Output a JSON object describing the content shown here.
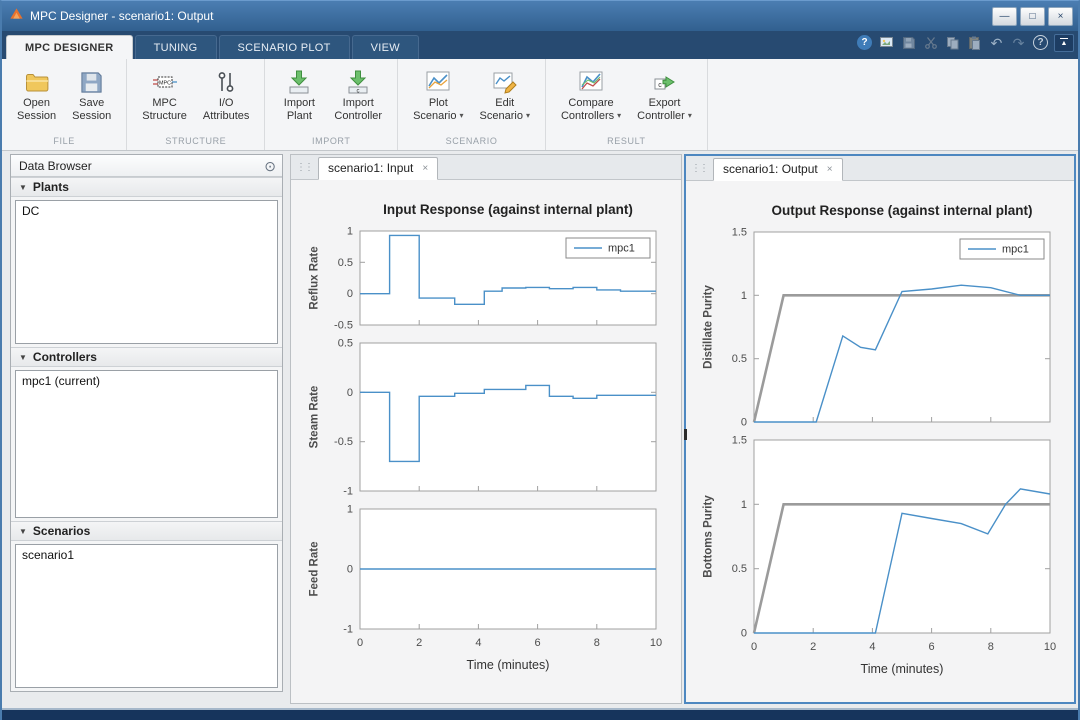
{
  "window": {
    "title": "MPC Designer - scenario1: Output",
    "controls": {
      "minimize": "—",
      "maximize": "□",
      "close": "×"
    }
  },
  "icons": {
    "dropdown_arrow": "▾",
    "section_collapse": "▼",
    "close_tab": "×",
    "help_glyph": "?",
    "undo_glyph": "↶",
    "redo_glyph": "↷",
    "panel_menu_glyph": "⊙",
    "handle_glyph": "⋮⋮",
    "collapse_ribbon_glyph": "▲",
    "mpc_badge": "MPC",
    "controller_badge": "c"
  },
  "ribbon": {
    "tabs": [
      {
        "label": "MPC DESIGNER",
        "active": true
      },
      {
        "label": "TUNING",
        "active": false
      },
      {
        "label": "SCENARIO PLOT",
        "active": false
      },
      {
        "label": "VIEW",
        "active": false
      }
    ],
    "quick_access": [
      "help",
      "screenshot",
      "save",
      "cut",
      "copy",
      "paste",
      "undo",
      "redo",
      "help-circle",
      "minimize-ribbon"
    ],
    "groups": [
      {
        "label": "FILE",
        "buttons": [
          {
            "line1": "Open",
            "line2": "Session",
            "menu": false
          },
          {
            "line1": "Save",
            "line2": "Session",
            "menu": false
          }
        ]
      },
      {
        "label": "STRUCTURE",
        "buttons": [
          {
            "line1": "MPC",
            "line2": "Structure",
            "menu": false
          },
          {
            "line1": "I/O",
            "line2": "Attributes",
            "menu": false
          }
        ]
      },
      {
        "label": "IMPORT",
        "buttons": [
          {
            "line1": "Import",
            "line2": "Plant",
            "menu": false
          },
          {
            "line1": "Import",
            "line2": "Controller",
            "menu": false
          }
        ]
      },
      {
        "label": "SCENARIO",
        "buttons": [
          {
            "line1": "Plot",
            "line2": "Scenario",
            "menu": true
          },
          {
            "line1": "Edit",
            "line2": "Scenario",
            "menu": true
          }
        ]
      },
      {
        "label": "RESULT",
        "buttons": [
          {
            "line1": "Compare",
            "line2": "Controllers",
            "menu": true
          },
          {
            "line1": "Export",
            "line2": "Controller",
            "menu": true
          }
        ]
      }
    ]
  },
  "data_browser": {
    "title": "Data Browser",
    "sections": [
      {
        "label": "Plants",
        "items": [
          "DC"
        ]
      },
      {
        "label": "Controllers",
        "items": [
          "mpc1 (current)"
        ]
      },
      {
        "label": "Scenarios",
        "items": [
          "scenario1"
        ]
      }
    ]
  },
  "documents": [
    {
      "tab": "scenario1: Input"
    },
    {
      "tab": "scenario1: Output",
      "focused": true
    }
  ],
  "colors": {
    "mpc_line": "#4a90c8",
    "reference_line": "#9b9b9b",
    "focus_border": "#4d87c0",
    "titlebar": "#31608f"
  },
  "chart_data": [
    {
      "type": "line",
      "title": "Input Response (against internal plant)",
      "xlabel": "Time (minutes)",
      "xlim": [
        0,
        10
      ],
      "xticks": [
        0,
        2,
        4,
        6,
        8,
        10
      ],
      "grid": false,
      "legend_position": "top-right",
      "subplots": [
        {
          "ylabel": "Reflux Rate",
          "ylim": [
            -0.5,
            1
          ],
          "yticks": [
            1,
            0.5,
            0,
            -0.5
          ],
          "legend": [
            {
              "label": "mpc1",
              "color": "#4a90c8"
            }
          ],
          "series": [
            {
              "name": "mpc1",
              "color": "#4a90c8",
              "width": 1.4,
              "x": [
                0,
                1,
                1,
                2,
                2,
                3.2,
                3.2,
                4.2,
                4.2,
                4.8,
                4.8,
                5.6,
                5.6,
                6.4,
                6.4,
                7.2,
                7.2,
                8,
                8,
                8.8,
                8.8,
                10
              ],
              "y": [
                0,
                0,
                0.93,
                0.93,
                -0.07,
                -0.07,
                -0.17,
                -0.17,
                0.04,
                0.04,
                0.09,
                0.09,
                0.1,
                0.1,
                0.08,
                0.08,
                0.1,
                0.1,
                0.06,
                0.06,
                0.04,
                0.04
              ]
            }
          ]
        },
        {
          "ylabel": "Steam Rate",
          "ylim": [
            -1,
            0.5
          ],
          "yticks": [
            0.5,
            0,
            -0.5,
            -1
          ],
          "series": [
            {
              "name": "mpc1",
              "color": "#4a90c8",
              "width": 1.4,
              "x": [
                0,
                1,
                1,
                2,
                2,
                3.2,
                3.2,
                4.2,
                4.2,
                5.6,
                5.6,
                6.4,
                6.4,
                7.2,
                7.2,
                8,
                8,
                10
              ],
              "y": [
                0,
                0,
                -0.7,
                -0.7,
                -0.04,
                -0.04,
                -0.01,
                -0.01,
                0.03,
                0.03,
                0.07,
                0.07,
                -0.04,
                -0.04,
                -0.06,
                -0.06,
                -0.03,
                -0.03
              ]
            }
          ]
        },
        {
          "ylabel": "Feed Rate",
          "ylim": [
            -1,
            1
          ],
          "yticks": [
            1,
            0,
            -1
          ],
          "series": [
            {
              "name": "mpc1",
              "color": "#4a90c8",
              "width": 1.4,
              "x": [
                0,
                10
              ],
              "y": [
                0,
                0
              ]
            }
          ]
        }
      ]
    },
    {
      "type": "line",
      "title": "Output Response (against internal plant)",
      "xlabel": "Time (minutes)",
      "xlim": [
        0,
        10
      ],
      "xticks": [
        0,
        2,
        4,
        6,
        8,
        10
      ],
      "grid": false,
      "legend_position": "top-right",
      "subplots": [
        {
          "ylabel": "Distillate Purity",
          "ylim": [
            0,
            1.5
          ],
          "yticks": [
            1.5,
            1,
            0.5,
            0
          ],
          "legend": [
            {
              "label": "mpc1",
              "color": "#4a90c8"
            }
          ],
          "series": [
            {
              "name": "setpoint",
              "color": "#9b9b9b",
              "width": 2.6,
              "x": [
                0,
                1,
                10
              ],
              "y": [
                0,
                1,
                1
              ]
            },
            {
              "name": "mpc1",
              "color": "#4a90c8",
              "width": 1.4,
              "x": [
                0,
                2.1,
                3,
                3.6,
                4.1,
                5,
                6,
                7,
                8,
                9,
                10
              ],
              "y": [
                0,
                0,
                0.68,
                0.59,
                0.57,
                1.03,
                1.05,
                1.08,
                1.06,
                1.0,
                1.0
              ]
            }
          ]
        },
        {
          "ylabel": "Bottoms Purity",
          "ylim": [
            0,
            1.5
          ],
          "yticks": [
            1.5,
            1,
            0.5,
            0
          ],
          "series": [
            {
              "name": "setpoint",
              "color": "#9b9b9b",
              "width": 2.6,
              "x": [
                0,
                1,
                10
              ],
              "y": [
                0,
                1,
                1
              ]
            },
            {
              "name": "mpc1",
              "color": "#4a90c8",
              "width": 1.4,
              "x": [
                0,
                4.1,
                5,
                6,
                7,
                7.9,
                8.5,
                9,
                10
              ],
              "y": [
                0,
                0,
                0.93,
                0.89,
                0.85,
                0.77,
                1.0,
                1.12,
                1.08
              ]
            }
          ]
        }
      ]
    }
  ]
}
